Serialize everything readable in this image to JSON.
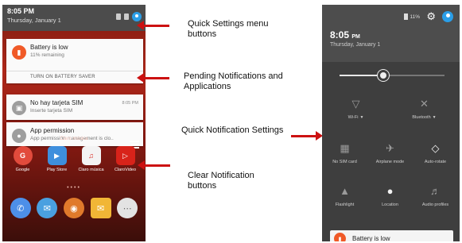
{
  "left_phone": {
    "status": {
      "time": "8:05 PM",
      "date": "Thursday, January 1"
    },
    "notifications": [
      {
        "title": "Battery is low",
        "subtitle": "11% remaining",
        "action": "TURN ON BATTERY SAVER",
        "icon": "battery-alert-icon",
        "color": "#f05a28"
      },
      {
        "title": "No hay tarjeta SIM",
        "subtitle": "Inserte tarjeta SIM",
        "time": "8:05 PM",
        "icon": "sim-icon",
        "color": "#9e9e9e"
      },
      {
        "title": "App permission",
        "subtitle": "App permission management is clo..",
        "icon": "lock-icon",
        "color": "#9e9e9e"
      }
    ],
    "carrier": "Claro música",
    "apps": [
      {
        "label": "Google",
        "icon": "google-icon",
        "color": "#e24b3c"
      },
      {
        "label": "Play Store",
        "icon": "play-store-icon",
        "color": "#3e8fdd"
      },
      {
        "label": "Claro música",
        "icon": "claro-musica-icon",
        "color": "#f3f3f3"
      },
      {
        "label": "ClaroVideo",
        "icon": "claro-video-icon",
        "color": "#d8231a"
      }
    ],
    "dock": [
      {
        "icon": "phone-icon",
        "color": "#4d8fe8"
      },
      {
        "icon": "messaging-icon",
        "color": "#4aa0e0"
      },
      {
        "icon": "browser-icon",
        "color": "#e07a2b"
      },
      {
        "icon": "email-icon",
        "color": "#f1b636"
      },
      {
        "icon": "app-drawer-icon",
        "color": "#e3e3e3"
      }
    ]
  },
  "labels": {
    "quick_settings": "Quick Settings menu buttons",
    "pending": "Pending Notifications and Applications",
    "quick_notification": "Quick Notification Settings",
    "clear": "Clear Notification buttons"
  },
  "right_phone": {
    "battery": "11%",
    "time": "8:05",
    "ampm": "PM",
    "date": "Thursday, January 1",
    "brightness_level": 0.42,
    "tiles_row1": [
      {
        "label": "Wi-Fi",
        "icon": "wifi-off-icon",
        "dropdown": true
      },
      {
        "label": "Bluetooth",
        "icon": "bluetooth-off-icon",
        "dropdown": true
      }
    ],
    "tiles_row2": [
      {
        "label": "No SIM card",
        "icon": "no-sim-icon"
      },
      {
        "label": "Airplane mode",
        "icon": "airplane-icon"
      },
      {
        "label": "Auto-rotate",
        "icon": "auto-rotate-icon"
      }
    ],
    "tiles_row3": [
      {
        "label": "Flashlight",
        "icon": "flashlight-icon"
      },
      {
        "label": "Location",
        "icon": "location-icon"
      },
      {
        "label": "Audio profiles",
        "icon": "audio-profiles-icon"
      }
    ],
    "notification": {
      "title": "Battery is low",
      "icon": "battery-alert-icon",
      "color": "#f05a28"
    }
  }
}
